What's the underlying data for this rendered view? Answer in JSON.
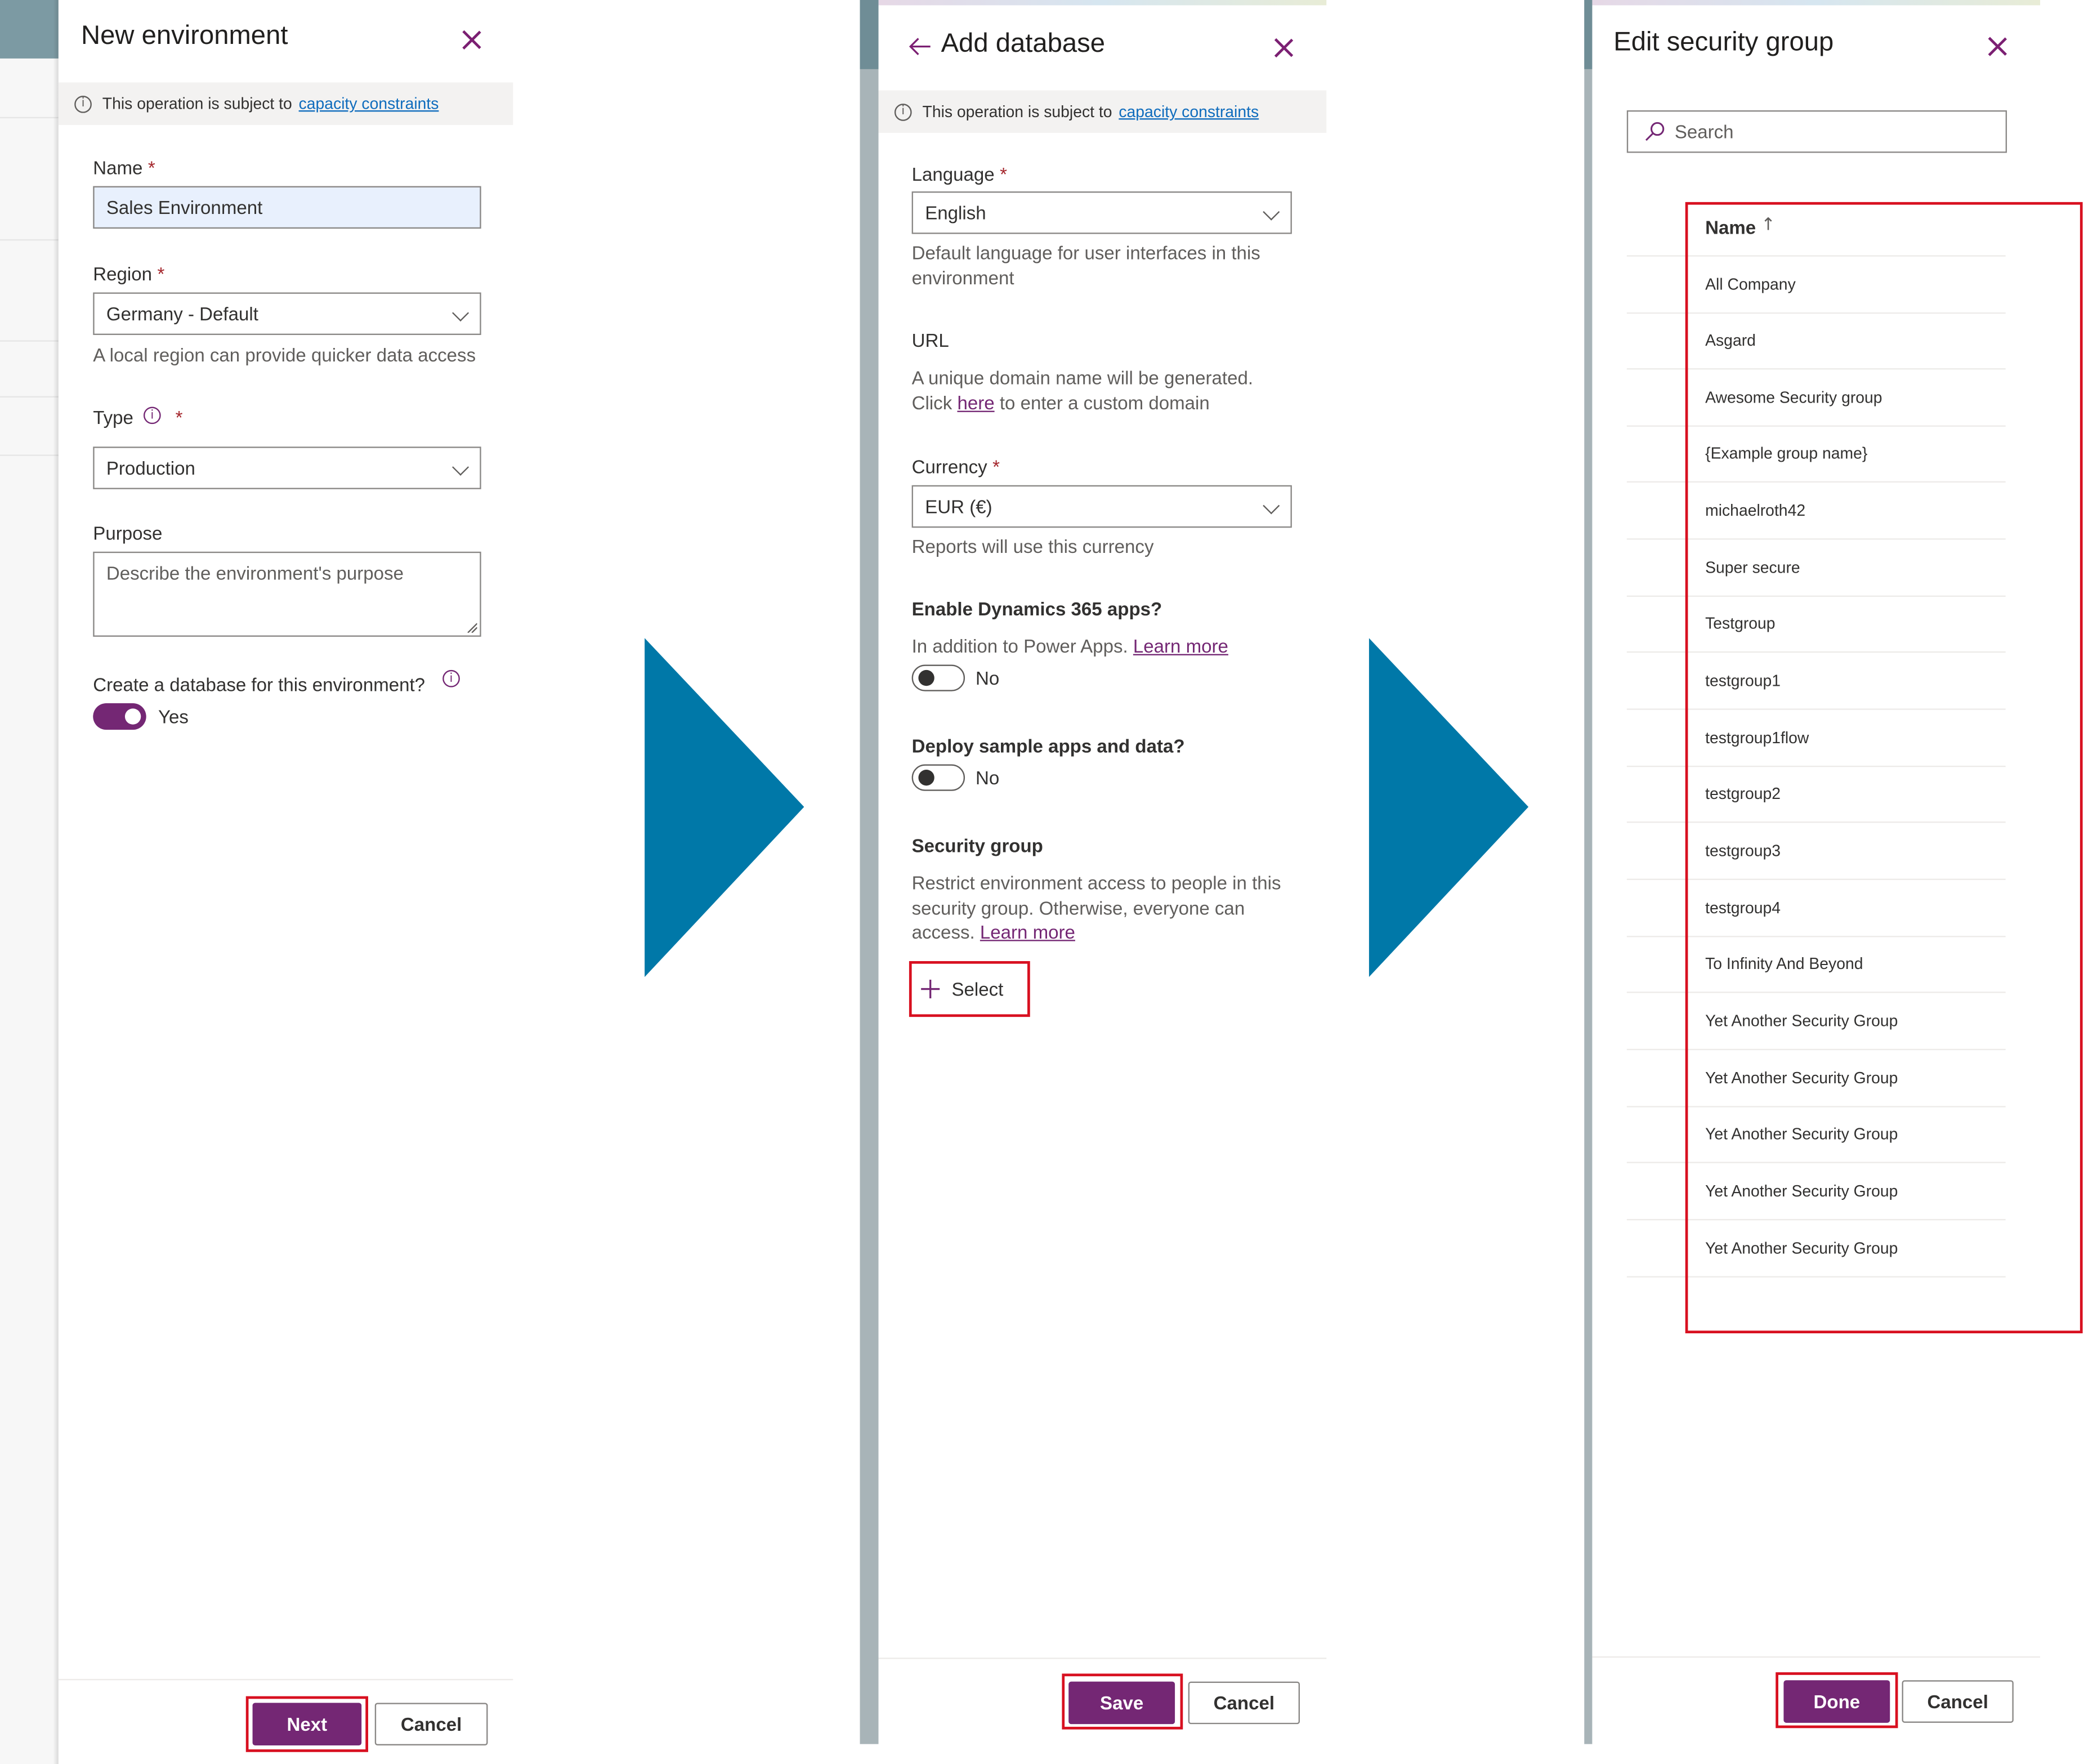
{
  "panel1": {
    "title": "New environment",
    "notice_text": "This operation is subject to",
    "notice_link": "capacity constraints",
    "name_label": "Name",
    "name_value": "Sales Environment",
    "region_label": "Region",
    "region_value": "Germany - Default",
    "region_help": "A local region can provide quicker data access",
    "type_label": "Type",
    "type_value": "Production",
    "purpose_label": "Purpose",
    "purpose_placeholder": "Describe the environment's purpose",
    "database_label": "Create a database for this environment?",
    "database_toggle_text": "Yes",
    "next_label": "Next",
    "cancel_label": "Cancel"
  },
  "panel2": {
    "title": "Add database",
    "notice_text": "This operation is subject to",
    "notice_link": "capacity constraints",
    "language_label": "Language",
    "language_value": "English",
    "language_help": "Default language for user interfaces in this environment",
    "url_label": "URL",
    "url_help_1": "A unique domain name will be generated.",
    "url_help_2a": "Click",
    "url_help_link": "here",
    "url_help_2b": "to enter a custom domain",
    "currency_label": "Currency",
    "currency_value": "EUR (€)",
    "currency_help": "Reports will use this currency",
    "dynamics_label": "Enable Dynamics 365 apps?",
    "dynamics_help": "In addition to Power Apps.",
    "dynamics_link": "Learn more",
    "dynamics_toggle_text": "No",
    "sample_label": "Deploy sample apps and data?",
    "sample_toggle_text": "No",
    "security_label": "Security group",
    "security_help_1": "Restrict environment access to people in this",
    "security_help_2": "security group. Otherwise, everyone can",
    "security_help_3": "access.",
    "security_link": "Learn more",
    "select_label": "Select",
    "save_label": "Save",
    "cancel_label": "Cancel"
  },
  "panel3": {
    "title": "Edit security group",
    "search_placeholder": "Search",
    "column_header": "Name",
    "groups": [
      "All Company",
      "Asgard",
      "Awesome Security group",
      "{Example group name}",
      "michaelroth42",
      "Super secure",
      "Testgroup",
      "testgroup1",
      "testgroup1flow",
      "testgroup2",
      "testgroup3",
      "testgroup4",
      "To Infinity And Beyond",
      "Yet Another Security Group",
      "Yet Another Security Group",
      "Yet Another Security Group",
      "Yet Another Security Group",
      "Yet Another Security Group"
    ],
    "done_label": "Done",
    "cancel_label": "Cancel"
  },
  "colors": {
    "accent": "#742774",
    "arrow": "#0078a8",
    "highlight": "#d81020"
  }
}
